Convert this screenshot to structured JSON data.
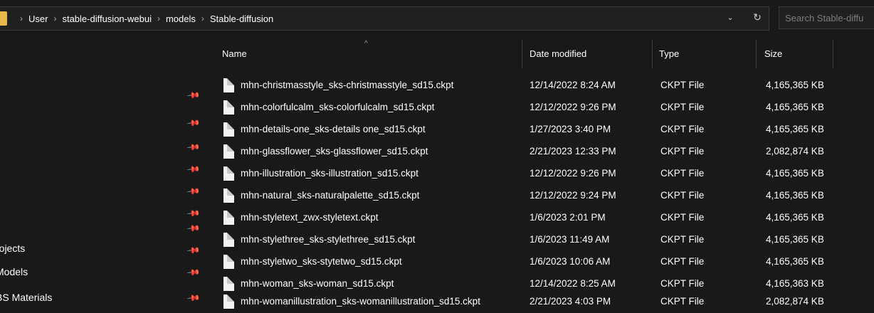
{
  "breadcrumb": [
    "User",
    "stable-diffusion-webui",
    "models",
    "Stable-diffusion"
  ],
  "breadcrumb_separator": "›",
  "search_placeholder": "Search Stable-diffu",
  "nav_labels": [
    "rojects",
    "Models",
    "BS Materials"
  ],
  "columns": {
    "name": "Name",
    "date": "Date modified",
    "type": "Type",
    "size": "Size"
  },
  "files": [
    {
      "name": "mhn-christmasstyle_sks-christmasstyle_sd15.ckpt",
      "date": "12/14/2022 8:24 AM",
      "type": "CKPT File",
      "size": "4,165,365 KB"
    },
    {
      "name": "mhn-colorfulcalm_sks-colorfulcalm_sd15.ckpt",
      "date": "12/12/2022 9:26 PM",
      "type": "CKPT File",
      "size": "4,165,365 KB"
    },
    {
      "name": "mhn-details-one_sks-details one_sd15.ckpt",
      "date": "1/27/2023 3:40 PM",
      "type": "CKPT File",
      "size": "4,165,365 KB"
    },
    {
      "name": "mhn-glassflower_sks-glassflower_sd15.ckpt",
      "date": "2/21/2023 12:33 PM",
      "type": "CKPT File",
      "size": "2,082,874 KB"
    },
    {
      "name": "mhn-illustration_sks-illustration_sd15.ckpt",
      "date": "12/12/2022 9:26 PM",
      "type": "CKPT File",
      "size": "4,165,365 KB"
    },
    {
      "name": "mhn-natural_sks-naturalpalette_sd15.ckpt",
      "date": "12/12/2022 9:24 PM",
      "type": "CKPT File",
      "size": "4,165,365 KB"
    },
    {
      "name": "mhn-styletext_zwx-styletext.ckpt",
      "date": "1/6/2023 2:01 PM",
      "type": "CKPT File",
      "size": "4,165,365 KB"
    },
    {
      "name": "mhn-stylethree_sks-stylethree_sd15.ckpt",
      "date": "1/6/2023 11:49 AM",
      "type": "CKPT File",
      "size": "4,165,365 KB"
    },
    {
      "name": "mhn-styletwo_sks-stytetwo_sd15.ckpt",
      "date": "1/6/2023 10:06 AM",
      "type": "CKPT File",
      "size": "4,165,365 KB"
    },
    {
      "name": "mhn-woman_sks-woman_sd15.ckpt",
      "date": "12/14/2022 8:25 AM",
      "type": "CKPT File",
      "size": "4,165,363 KB"
    },
    {
      "name": "mhn-womanillustration_sks-womanillustration_sd15.ckpt",
      "date": "2/21/2023 4:03 PM",
      "type": "CKPT File",
      "size": "2,082,874 KB"
    }
  ],
  "colors": {
    "background": "#191919",
    "folder": "#e8b94a",
    "text": "#ffffff"
  }
}
